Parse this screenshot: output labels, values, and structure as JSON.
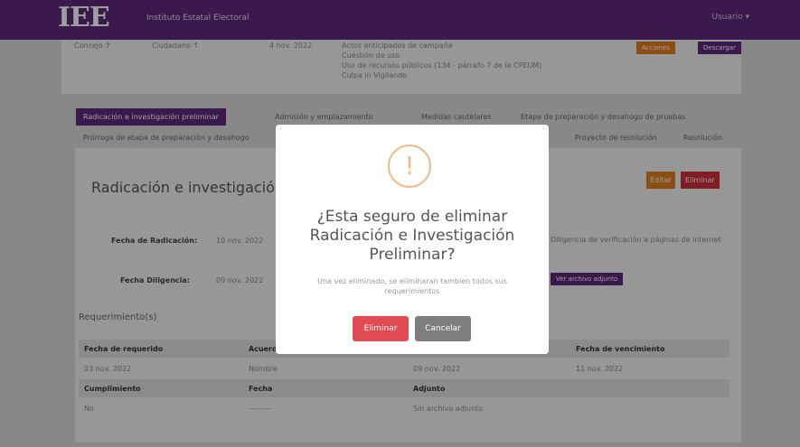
{
  "header": {
    "logo": "IEE",
    "org_name": "Instituto Estatal Electoral",
    "user_menu": "Usuario ▾"
  },
  "top_card": {
    "col1": "Consejo ↑",
    "col2": "Ciudadano ↑",
    "date": "4 nov. 2022",
    "notes": [
      "Actos anticipados de campaña",
      "Cuestión de uso",
      "Uso de recursos públicos (134 - párrafo 7 de la CPEUM)",
      "Culpa in Vigilando"
    ],
    "btn_orange": "Acciones",
    "btn_purple": "Descargar"
  },
  "tabs": [
    {
      "label": "Radicación e investigación preliminar",
      "active": true
    },
    {
      "label": "Admisión y emplazamiento"
    },
    {
      "label": "Medidas cautelares"
    },
    {
      "label": "Etapa de preparación y desahogo de pruebas"
    },
    {
      "label": "Prórroga de etapa de preparación y desahogo"
    },
    {
      "label": "Proyecto de resolución"
    },
    {
      "label": "Resolución"
    }
  ],
  "section": {
    "title": "Radicación e investigación p",
    "edit_btn": "Editar",
    "delete_btn": "Eliminar",
    "fecha_radicacion_label": "Fecha de Radicación:",
    "fecha_radicacion_value": "10 nov. 2022",
    "fecha_diligencia_label": "Fecha Diligencia:",
    "fecha_diligencia_value": "09 nov. 2022",
    "right_note": "Diligencia de verificación a páginas de internet",
    "attach_btn": "Ver archivo adjunto",
    "requirements_title": "Requerimiento(s)"
  },
  "table": {
    "headers": [
      "Fecha de requerido",
      "Acuerdo",
      "",
      "Fecha de vencimiento"
    ],
    "row": [
      "03 nov. 2022",
      "Nombre",
      "09 nov. 2022",
      "11 nov. 2022"
    ],
    "headers2": [
      "Cumplimiento",
      "Fecha",
      "Adjunto"
    ],
    "row2": [
      "No",
      "---------",
      "Sin archivo adjunto"
    ]
  },
  "modal": {
    "icon": "!",
    "title": "¿Esta seguro de eliminar Radicación e Investigación Preliminar?",
    "text": "Una vez eliminado, se eliminaran tambien todos sus requerimientos",
    "confirm": "Eliminar",
    "cancel": "Cancelar"
  }
}
